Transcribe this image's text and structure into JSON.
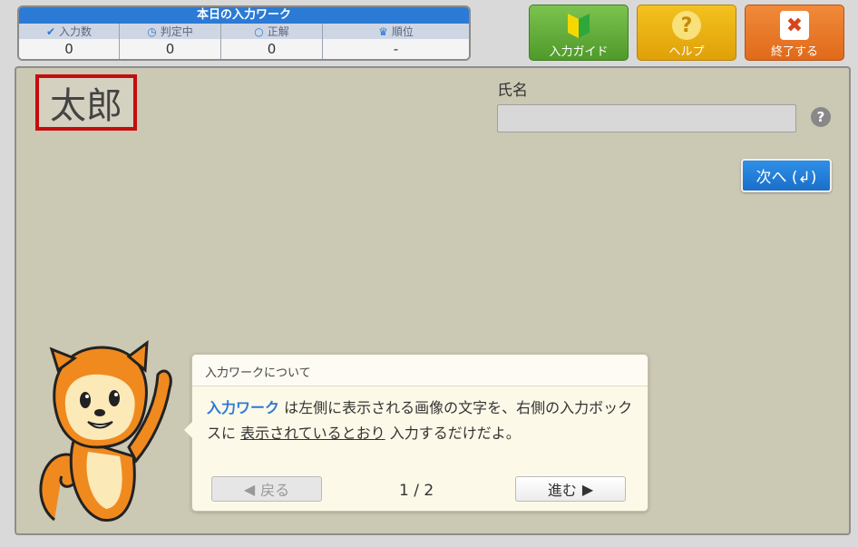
{
  "stats": {
    "title": "本日の入力ワーク",
    "columns": [
      {
        "icon": "check-icon",
        "label": "入力数",
        "value": "0"
      },
      {
        "icon": "clock-icon",
        "label": "判定中",
        "value": "0"
      },
      {
        "icon": "circle-icon",
        "label": "正解",
        "value": "0"
      },
      {
        "icon": "crown-icon",
        "label": "順位",
        "value": "-"
      }
    ]
  },
  "toolbar": {
    "guide_label": "入力ガイド",
    "help_label": "ヘルプ",
    "exit_label": "終了する"
  },
  "task": {
    "sample_text": "太郎",
    "field_label": "氏名",
    "field_value": "",
    "help_mark": "?",
    "next_label": "次へ (↲)"
  },
  "dialog": {
    "title": "入力ワークについて",
    "highlight": "入力ワーク",
    "text1": " は左側に表示される画像の文字を、右側の入力ボックスに ",
    "underlined": "表示されているとおり",
    "text2": " 入力するだけだよ。",
    "back_label": "戻る",
    "forward_label": "進む",
    "page_indicator": "1 / 2"
  },
  "colors": {
    "accent": "#2b7ad6",
    "guide": "#5ea835",
    "help": "#e8b00e",
    "exit": "#e6721f",
    "sample_border": "#c40d0d"
  }
}
